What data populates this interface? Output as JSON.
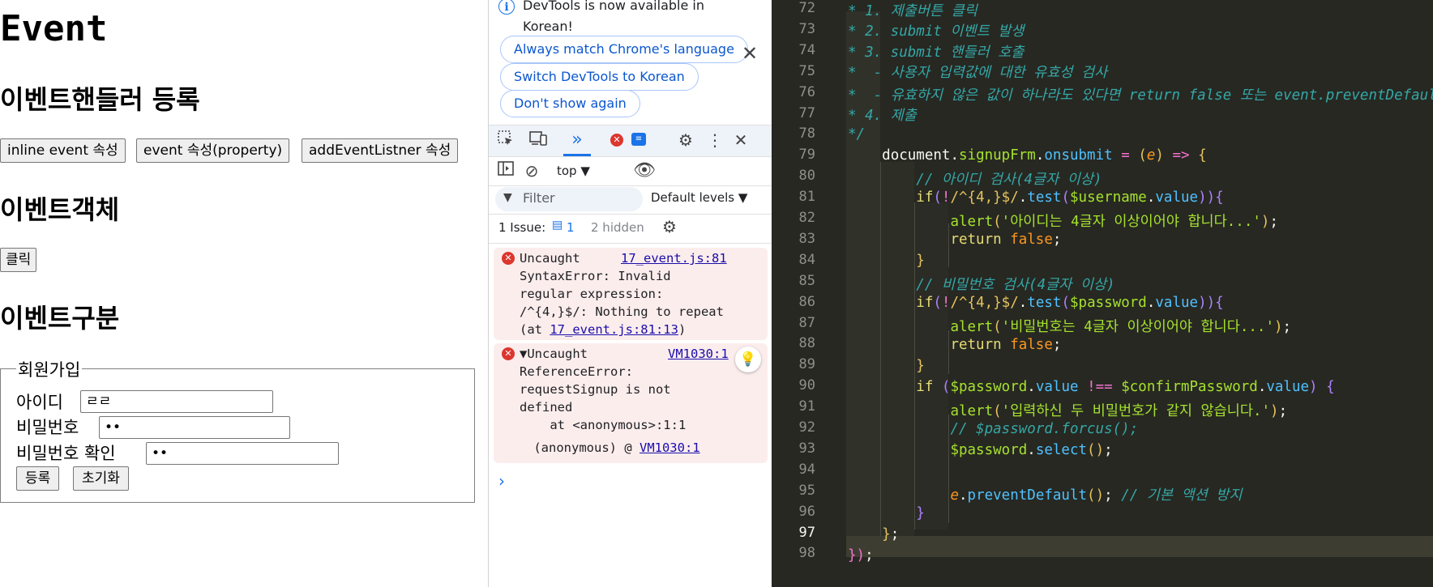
{
  "web": {
    "title": "Event",
    "section1": "이벤트핸들러 등록",
    "buttons": [
      "inline event 속성",
      "event 속성(property)",
      "addEventListner 속성"
    ],
    "section2": "이벤트객체",
    "click_btn": "클릭",
    "section3": "이벤트구분",
    "legend": "회원가입",
    "id_label": "아이디",
    "id_value": "ㄹㄹ",
    "pw_label": "비밀번호",
    "pw_value": "••",
    "pw2_label": "비밀번호 확인",
    "pw2_value": "••",
    "submit_btn": "등록",
    "reset_btn": "초기화"
  },
  "devtools": {
    "banner_text": "DevTools is now available in Korean!",
    "pill1": "Always match Chrome's language",
    "pill2": "Switch DevTools to Korean",
    "pill3": "Don't show again",
    "context": "top ▼",
    "filter_placeholder": "Filter",
    "levels": "Default levels ▼",
    "issues_label": "1 Issue:",
    "issues_count": "1",
    "hidden": "2 hidden",
    "err1": {
      "line1": "Uncaught",
      "link": "17_event.js:81",
      "line2": "SyntaxError: Invalid",
      "line3": "regular expression:",
      "line4": "/^{4,}$/: Nothing to repeat",
      "line5_pre": "(at ",
      "line5_link": "17_event.js:81:13",
      "line5_post": ")"
    },
    "err2": {
      "line1": "▼Uncaught",
      "link": "VM1030:1",
      "line2": "ReferenceError:",
      "line3": "requestSignup is not",
      "line4": "defined",
      "line5": "    at <anonymous>:1:1",
      "line6_pre": " (anonymous) @ ",
      "line6_link": "VM1030:1"
    },
    "prompt": "›"
  },
  "editor": {
    "line_numbers": [
      "72",
      "73",
      "74",
      "75",
      "76",
      "77",
      "78",
      "79",
      "80",
      "81",
      "82",
      "83",
      "84",
      "85",
      "86",
      "87",
      "88",
      "89",
      "90",
      "91",
      "92",
      "93",
      "94",
      "95",
      "96",
      "97",
      "98"
    ],
    "current_line": "97"
  }
}
